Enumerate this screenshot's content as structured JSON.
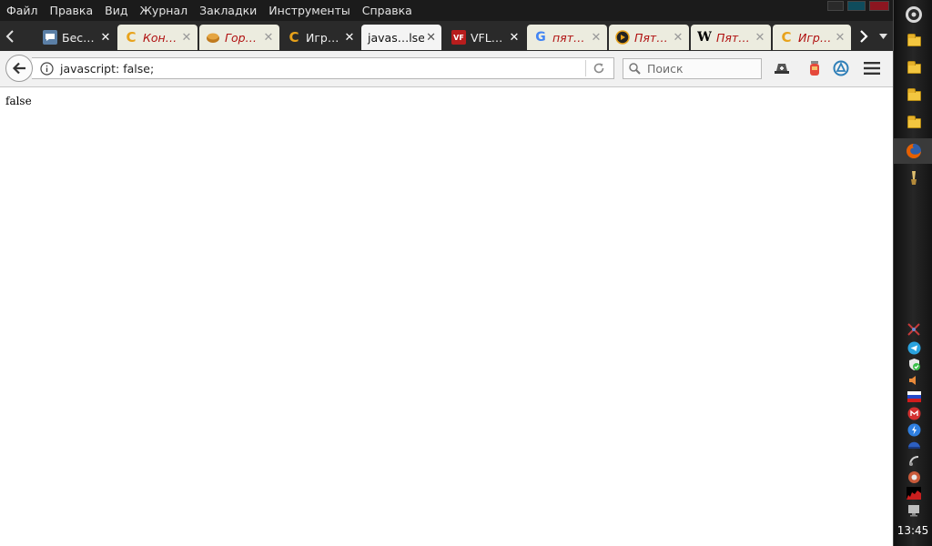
{
  "menubar": {
    "items": [
      "Файл",
      "Правка",
      "Вид",
      "Журнал",
      "Закладки",
      "Инструменты",
      "Справка"
    ]
  },
  "tabs": [
    {
      "label": "Бес…",
      "icon": "vk-icon",
      "state": "dark"
    },
    {
      "label": "Кон…",
      "icon": "casino-c-icon",
      "state": "light"
    },
    {
      "label": "Гор…",
      "icon": "pie-icon",
      "state": "light"
    },
    {
      "label": "Игр…",
      "icon": "casino-c-icon",
      "state": "dark"
    },
    {
      "label": "javas…lse;",
      "icon": "",
      "state": "active"
    },
    {
      "label": "VFL…",
      "icon": "vfl-icon",
      "state": "dark"
    },
    {
      "label": "пят…",
      "icon": "google-icon",
      "state": "light"
    },
    {
      "label": "Пят…",
      "icon": "play-circle-icon",
      "state": "light"
    },
    {
      "label": "Пят…",
      "icon": "wikipedia-icon",
      "state": "light"
    },
    {
      "label": "Игр…",
      "icon": "casino-c-icon",
      "state": "light"
    }
  ],
  "navbar": {
    "url": "javascript: false;",
    "search_placeholder": "Поиск"
  },
  "page": {
    "text": "false"
  },
  "sidepanel": {
    "clock": "13:45"
  },
  "colors": {
    "menubar_bg": "#1b1b1b",
    "tab_light_bg": "#ececdf",
    "tab_light_text": "#b01010",
    "firefox_orange": "#e66000"
  }
}
